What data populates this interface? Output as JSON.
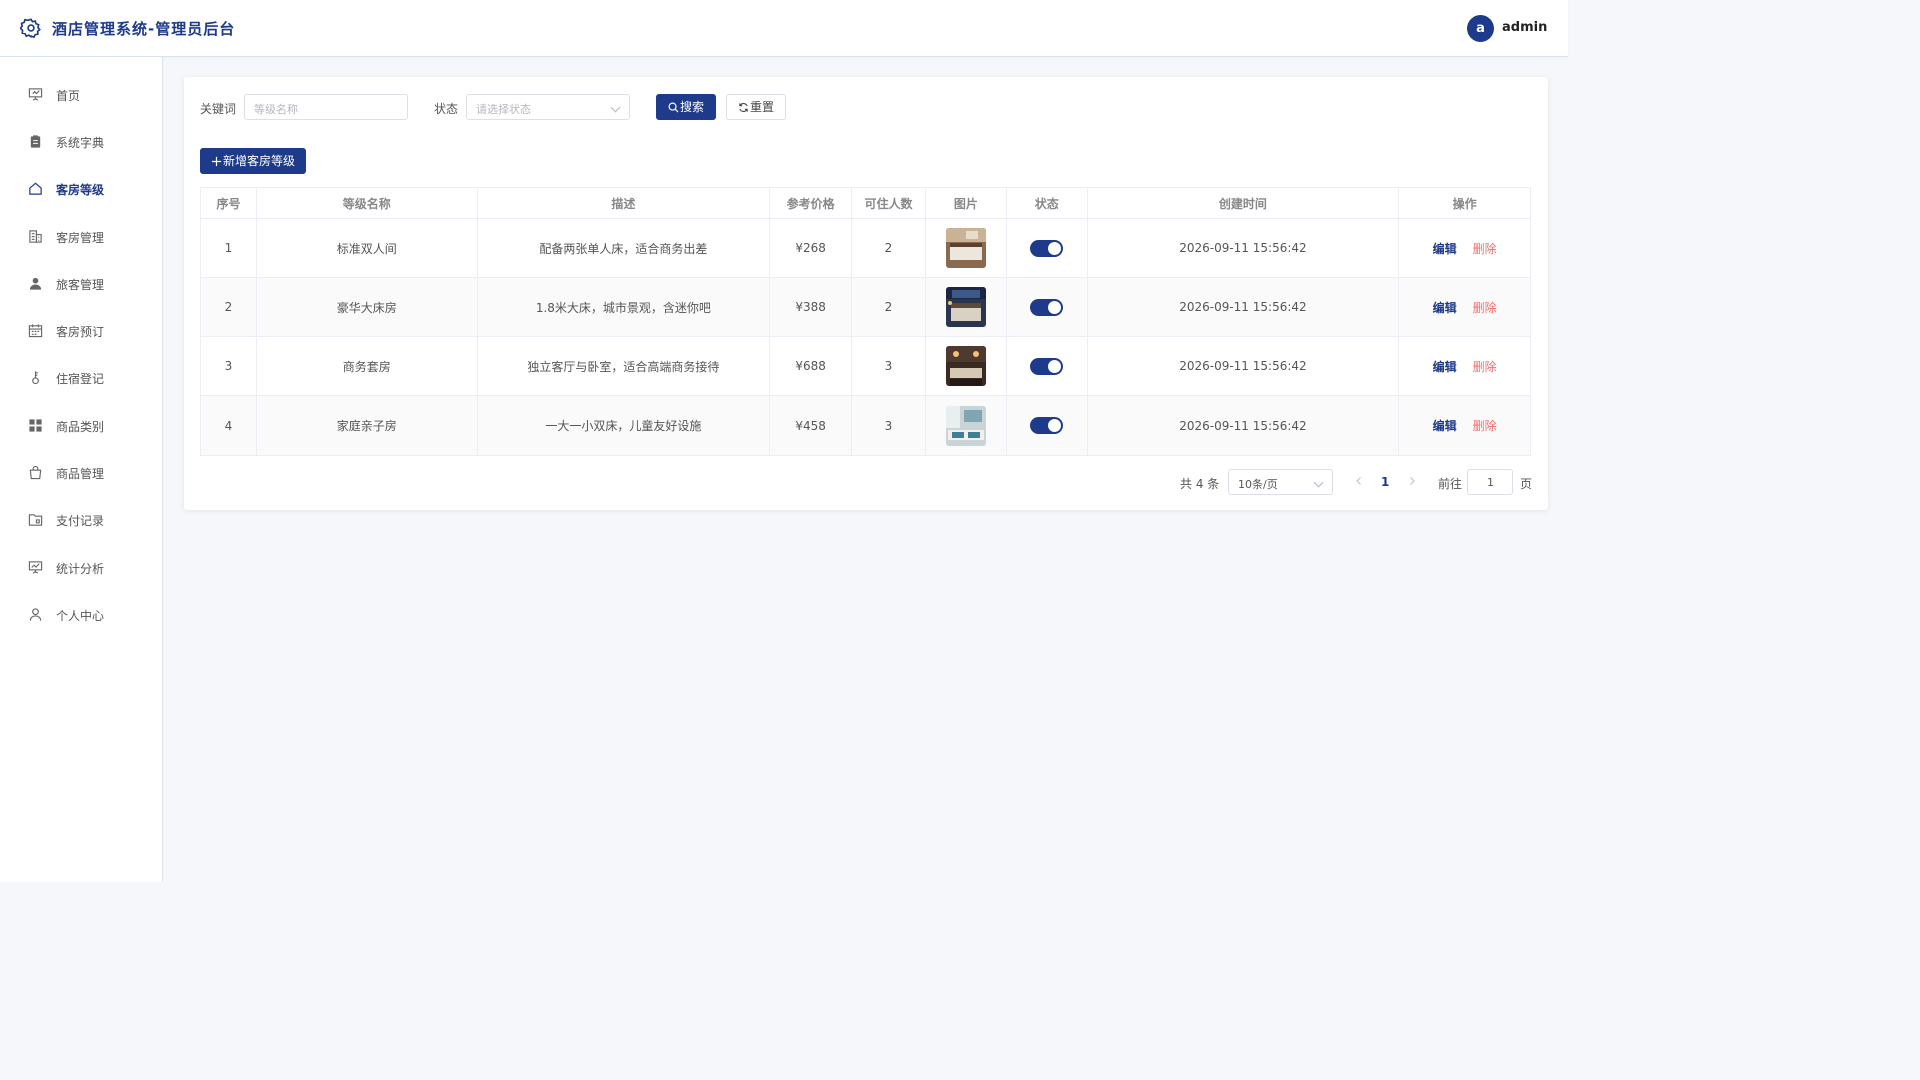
{
  "header": {
    "title": "酒店管理系统-管理员后台",
    "avatar_letter": "a",
    "username": "admin"
  },
  "sidebar": {
    "items": [
      {
        "label": "首页",
        "icon": "presentation-icon"
      },
      {
        "label": "系统字典",
        "icon": "clipboard-icon"
      },
      {
        "label": "客房等级",
        "icon": "house-icon",
        "active": true
      },
      {
        "label": "客房管理",
        "icon": "building-icon"
      },
      {
        "label": "旅客管理",
        "icon": "user-filled-icon"
      },
      {
        "label": "客房预订",
        "icon": "calendar-icon"
      },
      {
        "label": "住宿登记",
        "icon": "key-icon"
      },
      {
        "label": "商品类别",
        "icon": "grid-icon"
      },
      {
        "label": "商品管理",
        "icon": "shopping-bag-icon"
      },
      {
        "label": "支付记录",
        "icon": "folder-icon"
      },
      {
        "label": "统计分析",
        "icon": "chart-board-icon"
      },
      {
        "label": "个人中心",
        "icon": "user-outline-icon"
      }
    ]
  },
  "filters": {
    "keyword_label": "关键词",
    "keyword_placeholder": "等级名称",
    "status_label": "状态",
    "status_placeholder": "请选择状态",
    "search_label": "搜索",
    "reset_label": "重置"
  },
  "add_button_label": "新增客房等级",
  "table": {
    "columns": [
      "序号",
      "等级名称",
      "描述",
      "参考价格",
      "可住人数",
      "图片",
      "状态",
      "创建时间",
      "操作"
    ],
    "rows": [
      {
        "index": "1",
        "name": "标准双人间",
        "desc": "配备两张单人床，适合商务出差",
        "price": "¥268",
        "capacity": "2",
        "enabled": true,
        "created": "2026-09-11 15:56:42"
      },
      {
        "index": "2",
        "name": "豪华大床房",
        "desc": "1.8米大床，城市景观，含迷你吧",
        "price": "¥388",
        "capacity": "2",
        "enabled": true,
        "created": "2026-09-11 15:56:42"
      },
      {
        "index": "3",
        "name": "商务套房",
        "desc": "独立客厅与卧室，适合高端商务接待",
        "price": "¥688",
        "capacity": "3",
        "enabled": true,
        "created": "2026-09-11 15:56:42"
      },
      {
        "index": "4",
        "name": "家庭亲子房",
        "desc": "一大一小双床，儿童友好设施",
        "price": "¥458",
        "capacity": "3",
        "enabled": true,
        "created": "2026-09-11 15:56:42"
      }
    ],
    "edit_label": "编辑",
    "delete_label": "删除"
  },
  "pagination": {
    "total_text": "共 4 条",
    "page_size": "10条/页",
    "current_page": "1",
    "goto_label": "前往",
    "goto_value": "1",
    "page_suffix": "页"
  },
  "colors": {
    "primary": "#1e3a8a",
    "danger": "#f56c6c",
    "background": "#f5f7fa"
  }
}
